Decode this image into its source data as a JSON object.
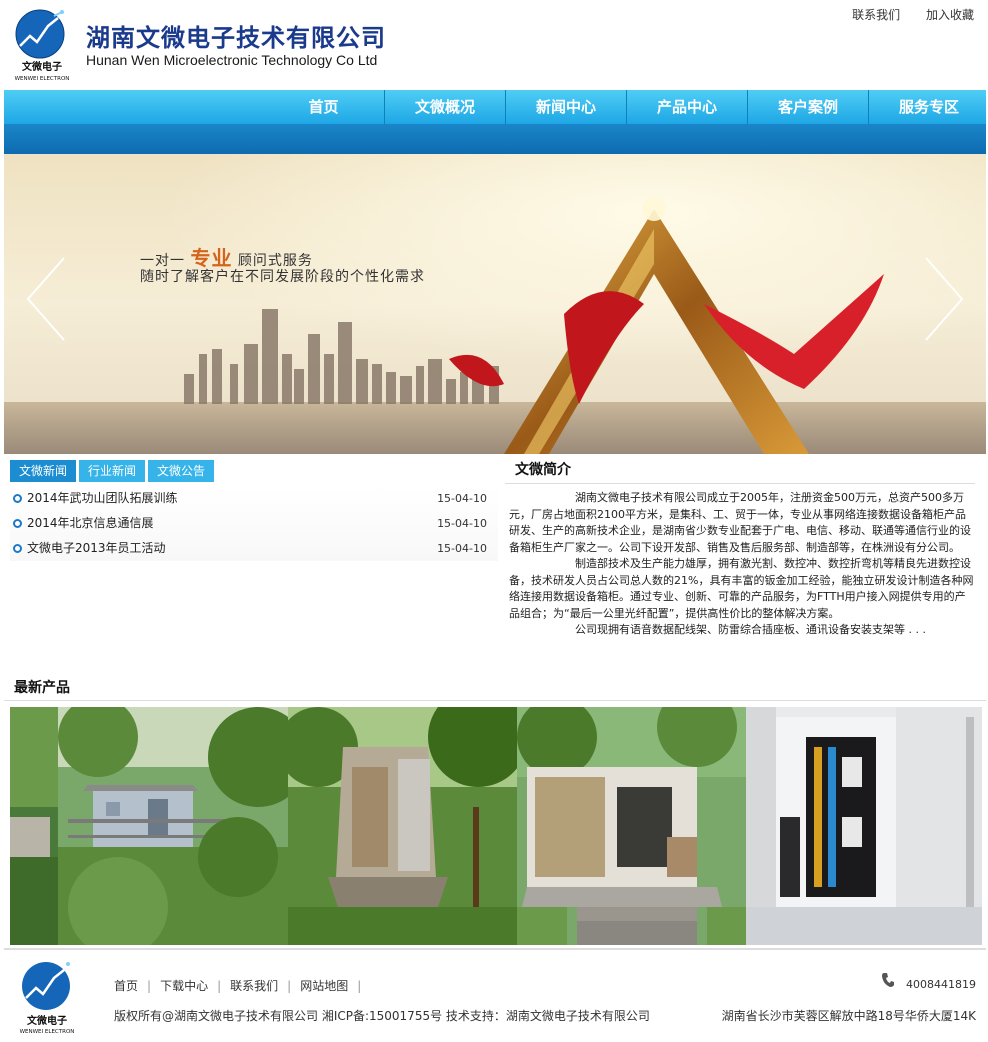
{
  "header": {
    "logo_text": "文微电子",
    "logo_subtext": "WENWEI ELECTRON",
    "company_cn": "湖南文微电子技术有限公司",
    "company_en": "Hunan Wen Microelectronic Technology Co Ltd",
    "top_links": [
      "联系我们",
      "加入收藏"
    ]
  },
  "nav": {
    "items": [
      "首页",
      "文微概况",
      "新闻中心",
      "产品中心",
      "客户案例",
      "服务专区"
    ]
  },
  "banner": {
    "slogan_prefix": "一对一",
    "slogan_highlight": "专业",
    "slogan_suffix": "顾问式服务",
    "slogan_line2": "随时了解客户在不同发展阶段的个性化需求"
  },
  "news": {
    "tabs": [
      "文微新闻",
      "行业新闻",
      "文微公告"
    ],
    "items": [
      {
        "title": "2014年武功山团队拓展训练",
        "date": "15-04-10"
      },
      {
        "title": "2014年北京信息通信展",
        "date": "15-04-10"
      },
      {
        "title": "文微电子2013年员工活动",
        "date": "15-04-10"
      }
    ]
  },
  "intro": {
    "title": "文微简介",
    "paragraphs": [
      "湖南文微电子技术有限公司成立于2005年，注册资金500万元，总资产500多万元，厂房占地面积2100平方米，是集科、工、贸于一体，专业从事网络连接数据设备箱柜产品研发、生产的高新技术企业，是湖南省少数专业配套于广电、电信、移动、联通等通信行业的设备箱柜生产厂家之一。公司下设开发部、销售及售后服务部、制造部等，在株洲设有分公司。",
      "制造部技术及生产能力雄厚，拥有激光割、数控冲、数控折弯机等精良先进数控设备，技术研发人员占公司总人数的21%，具有丰富的钣金加工经验，能独立研发设计制造各种网络连接用数据设备箱柜。通过专业、创新、可靠的产品服务，为FTTH用户接入网提供专用的产品组合；为“最后一公里光纤配置”，提供高性价比的整体解决方案。",
      "公司现拥有语音数据配线架、防雷综合插座板、通讯设备安装支架等 . . ."
    ]
  },
  "products": {
    "title": "最新产品"
  },
  "footer": {
    "links": [
      "首页",
      "下载中心",
      "联系我们",
      "网站地图"
    ],
    "copyright": "版权所有@湖南文微电子技术有限公司  湘ICP备:15001755号  技术支持：湖南文微电子技术有限公司",
    "phone": "4008441819",
    "address": "湖南省长沙市芙蓉区解放中路18号华侨大厦14K"
  }
}
